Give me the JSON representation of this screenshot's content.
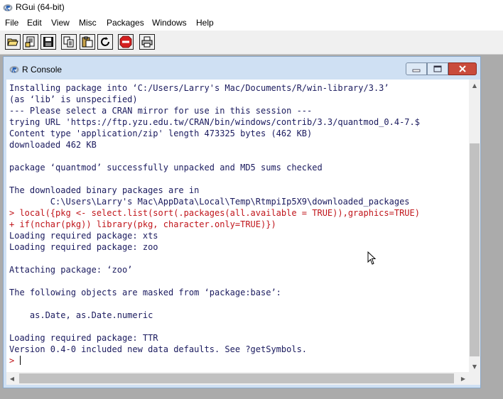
{
  "app": {
    "title": "RGui (64-bit)"
  },
  "menu": [
    "File",
    "Edit",
    "View",
    "Misc",
    "Packages",
    "Windows",
    "Help"
  ],
  "toolbar": {
    "buttons": [
      "open-script",
      "load-workspace",
      "save-workspace",
      "copy",
      "paste",
      "copy-paste",
      "stop",
      "print"
    ]
  },
  "console_window": {
    "title": "R Console"
  },
  "console": {
    "lines": [
      {
        "type": "out",
        "text": "Installing package into ‘C:/Users/Larry's Mac/Documents/R/win-library/3.3’"
      },
      {
        "type": "out",
        "text": "(as ‘lib’ is unspecified)"
      },
      {
        "type": "out",
        "text": "--- Please select a CRAN mirror for use in this session ---"
      },
      {
        "type": "out",
        "text": "trying URL 'https://ftp.yzu.edu.tw/CRAN/bin/windows/contrib/3.3/quantmod_0.4-7.$"
      },
      {
        "type": "out",
        "text": "Content type 'application/zip' length 473325 bytes (462 KB)"
      },
      {
        "type": "out",
        "text": "downloaded 462 KB"
      },
      {
        "type": "out",
        "text": ""
      },
      {
        "type": "out",
        "text": "package ‘quantmod’ successfully unpacked and MD5 sums checked"
      },
      {
        "type": "out",
        "text": ""
      },
      {
        "type": "out",
        "text": "The downloaded binary packages are in"
      },
      {
        "type": "out",
        "text": "        C:\\Users\\Larry's Mac\\AppData\\Local\\Temp\\RtmpiIp5X9\\downloaded_packages"
      },
      {
        "type": "in",
        "text": "> local({pkg <- select.list(sort(.packages(all.available = TRUE)),graphics=TRUE)"
      },
      {
        "type": "in",
        "text": "+ if(nchar(pkg)) library(pkg, character.only=TRUE)})"
      },
      {
        "type": "out",
        "text": "Loading required package: xts"
      },
      {
        "type": "out",
        "text": "Loading required package: zoo"
      },
      {
        "type": "out",
        "text": ""
      },
      {
        "type": "out",
        "text": "Attaching package: ‘zoo’"
      },
      {
        "type": "out",
        "text": ""
      },
      {
        "type": "out",
        "text": "The following objects are masked from ‘package:base’:"
      },
      {
        "type": "out",
        "text": ""
      },
      {
        "type": "out",
        "text": "    as.Date, as.Date.numeric"
      },
      {
        "type": "out",
        "text": ""
      },
      {
        "type": "out",
        "text": "Loading required package: TTR"
      },
      {
        "type": "out",
        "text": "Version 0.4-0 included new data defaults. See ?getSymbols."
      }
    ],
    "prompt": "> "
  },
  "colors": {
    "output_text": "#1a1a5e",
    "input_text": "#c0141a",
    "child_frame": "#cfe0f3",
    "close_button": "#c94b3c",
    "mdi_background": "#ababab"
  }
}
